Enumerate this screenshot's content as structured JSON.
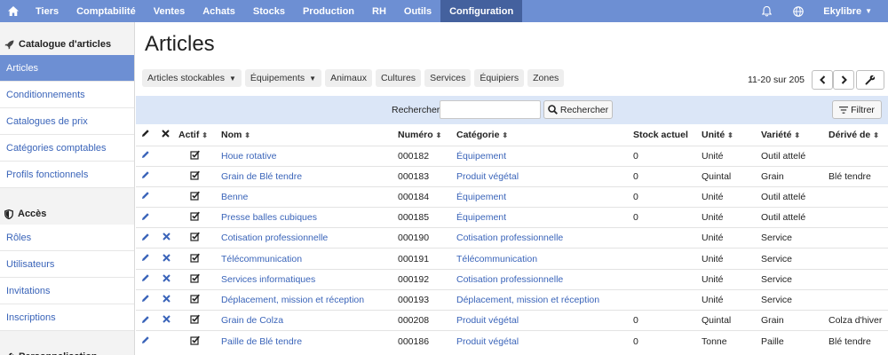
{
  "topbar": {
    "nav": [
      "Tiers",
      "Comptabilité",
      "Ventes",
      "Achats",
      "Stocks",
      "Production",
      "RH",
      "Outils",
      "Configuration"
    ],
    "active": "Configuration",
    "user": "Ekylibre"
  },
  "sidebar": {
    "sections": [
      {
        "title": "Catalogue d'articles",
        "icon": "rocket-icon",
        "items": [
          "Articles",
          "Conditionnements",
          "Catalogues de prix",
          "Catégories comptables",
          "Profils fonctionnels"
        ]
      },
      {
        "title": "Accès",
        "icon": "shield-icon",
        "items": [
          "Rôles",
          "Utilisateurs",
          "Invitations",
          "Inscriptions"
        ]
      },
      {
        "title": "Personnalisation",
        "icon": "wrench-icon",
        "items": []
      }
    ],
    "active_item": "Articles"
  },
  "main": {
    "title": "Articles",
    "chips": [
      {
        "label": "Articles stockables",
        "dropdown": true
      },
      {
        "label": "Équipements",
        "dropdown": true
      },
      {
        "label": "Animaux",
        "dropdown": false
      },
      {
        "label": "Cultures",
        "dropdown": false
      },
      {
        "label": "Services",
        "dropdown": false
      },
      {
        "label": "Équipiers",
        "dropdown": false
      },
      {
        "label": "Zones",
        "dropdown": false
      }
    ],
    "pagination": "11-20 sur 205",
    "search": {
      "label": "Rechercher",
      "button": "Rechercher",
      "value": ""
    },
    "filter_button": "Filtrer"
  },
  "table": {
    "headers": [
      "Actif",
      "Nom",
      "Numéro",
      "Catégorie",
      "Stock actuel",
      "Unité",
      "Variété",
      "Dérivé de"
    ],
    "rows": [
      {
        "deletable": false,
        "active": true,
        "name": "Houe rotative",
        "number": "000182",
        "category": "Équipement",
        "stock": "0",
        "unit": "Unité",
        "variety": "Outil attelé",
        "derived": ""
      },
      {
        "deletable": false,
        "active": true,
        "name": "Grain de Blé tendre",
        "number": "000183",
        "category": "Produit végétal",
        "stock": "0",
        "unit": "Quintal",
        "variety": "Grain",
        "derived": "Blé tendre"
      },
      {
        "deletable": false,
        "active": true,
        "name": "Benne",
        "number": "000184",
        "category": "Équipement",
        "stock": "0",
        "unit": "Unité",
        "variety": "Outil attelé",
        "derived": ""
      },
      {
        "deletable": false,
        "active": true,
        "name": "Presse balles cubiques",
        "number": "000185",
        "category": "Équipement",
        "stock": "0",
        "unit": "Unité",
        "variety": "Outil attelé",
        "derived": ""
      },
      {
        "deletable": true,
        "active": true,
        "name": "Cotisation professionnelle",
        "number": "000190",
        "category": "Cotisation professionnelle",
        "stock": "",
        "unit": "Unité",
        "variety": "Service",
        "derived": ""
      },
      {
        "deletable": true,
        "active": true,
        "name": "Télécommunication",
        "number": "000191",
        "category": "Télécommunication",
        "stock": "",
        "unit": "Unité",
        "variety": "Service",
        "derived": ""
      },
      {
        "deletable": true,
        "active": true,
        "name": "Services informatiques",
        "number": "000192",
        "category": "Cotisation professionnelle",
        "stock": "",
        "unit": "Unité",
        "variety": "Service",
        "derived": ""
      },
      {
        "deletable": true,
        "active": true,
        "name": "Déplacement, mission et réception",
        "number": "000193",
        "category": "Déplacement, mission et réception",
        "stock": "",
        "unit": "Unité",
        "variety": "Service",
        "derived": ""
      },
      {
        "deletable": true,
        "active": true,
        "name": "Grain de Colza",
        "number": "000208",
        "category": "Produit végétal",
        "stock": "0",
        "unit": "Quintal",
        "variety": "Grain",
        "derived": "Colza d'hiver"
      },
      {
        "deletable": false,
        "active": true,
        "name": "Paille de Blé tendre",
        "number": "000186",
        "category": "Produit végétal",
        "stock": "0",
        "unit": "Tonne",
        "variety": "Paille",
        "derived": "Blé tendre"
      }
    ]
  }
}
